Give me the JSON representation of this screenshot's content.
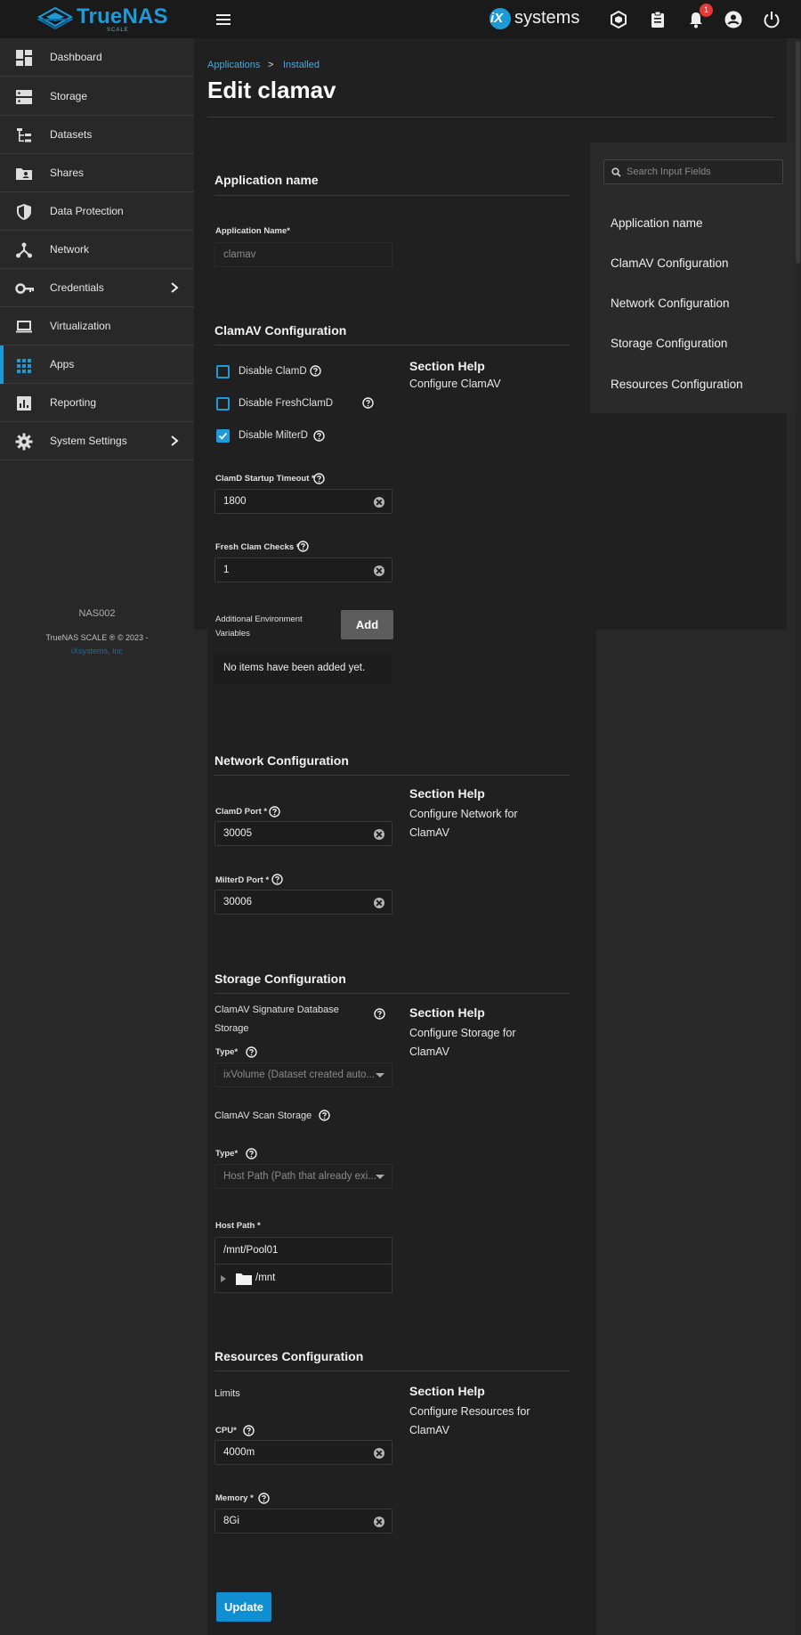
{
  "brand": {
    "name": "TrueNAS",
    "edition": "SCALE",
    "partner": "systems",
    "partner_mark": "iX"
  },
  "topbar": {
    "notifications_count": "1"
  },
  "sidebar": {
    "items": [
      {
        "label": "Dashboard",
        "icon": "dashboard-icon"
      },
      {
        "label": "Storage",
        "icon": "storage-icon"
      },
      {
        "label": "Datasets",
        "icon": "datasets-icon"
      },
      {
        "label": "Shares",
        "icon": "shares-icon"
      },
      {
        "label": "Data Protection",
        "icon": "shield-icon"
      },
      {
        "label": "Network",
        "icon": "network-icon"
      },
      {
        "label": "Credentials",
        "icon": "key-icon"
      },
      {
        "label": "Virtualization",
        "icon": "laptop-icon"
      },
      {
        "label": "Apps",
        "icon": "apps-grid-icon"
      },
      {
        "label": "Reporting",
        "icon": "reporting-icon"
      },
      {
        "label": "System Settings",
        "icon": "gear-icon"
      }
    ],
    "hostname": "NAS002",
    "copyright": "TrueNAS SCALE ® © 2023 -",
    "company": "iXsystems, Inc"
  },
  "breadcrumb": {
    "first": "Applications",
    "sep": ">",
    "second": "Installed"
  },
  "page_title": "Edit clamav",
  "search": {
    "placeholder": "Search Input Fields"
  },
  "jump_links": [
    "Application name",
    "ClamAV Configuration",
    "Network Configuration",
    "Storage Configuration",
    "Resources Configuration"
  ],
  "sections": {
    "appname": {
      "title": "Application name",
      "field_label": "Application Name",
      "value": "clamav"
    },
    "clamav": {
      "title": "ClamAV Configuration",
      "checkboxes": [
        {
          "label": "Disable ClamD",
          "checked": false
        },
        {
          "label": "Disable FreshClamD",
          "checked": false
        },
        {
          "label": "Disable MilterD",
          "checked": true
        }
      ],
      "startup_label": "ClamD Startup Timeout",
      "startup_value": "1800",
      "fresh_label": "Fresh Clam Checks",
      "fresh_value": "1",
      "env_label_1": "Additional Environment",
      "env_label_2": "Variables",
      "add_button": "Add",
      "empty_text": "No items have been added yet.",
      "help_title": "Section Help",
      "help_text": "Configure ClamAV"
    },
    "network": {
      "title": "Network Configuration",
      "clamd_port_label": "ClamD Port",
      "clamd_port_value": "30005",
      "milterd_port_label": "MilterD Port",
      "milterd_port_value": "30006",
      "help_title": "Section Help",
      "help_text": "Configure Network for ClamAV"
    },
    "storage": {
      "title": "Storage Configuration",
      "sig_label_1": "ClamAV Signature Database",
      "sig_label_2": "Storage",
      "type_label": "Type",
      "sig_type_value": "ixVolume (Dataset created auto...",
      "scan_label": "ClamAV Scan Storage",
      "scan_type_value": "Host Path (Path that already exi...",
      "host_path_label": "Host Path",
      "host_path_value": "/mnt/Pool01",
      "tree_node": "/mnt",
      "help_title": "Section Help",
      "help_text": "Configure Storage for ClamAV"
    },
    "resources": {
      "title": "Resources Configuration",
      "limits_label": "Limits",
      "cpu_label": "CPU",
      "cpu_value": "4000m",
      "memory_label": "Memory",
      "memory_value": "8Gi",
      "help_title": "Section Help",
      "help_text": "Configure Resources for ClamAV"
    }
  },
  "required_mark": "*",
  "update_button": "Update"
}
